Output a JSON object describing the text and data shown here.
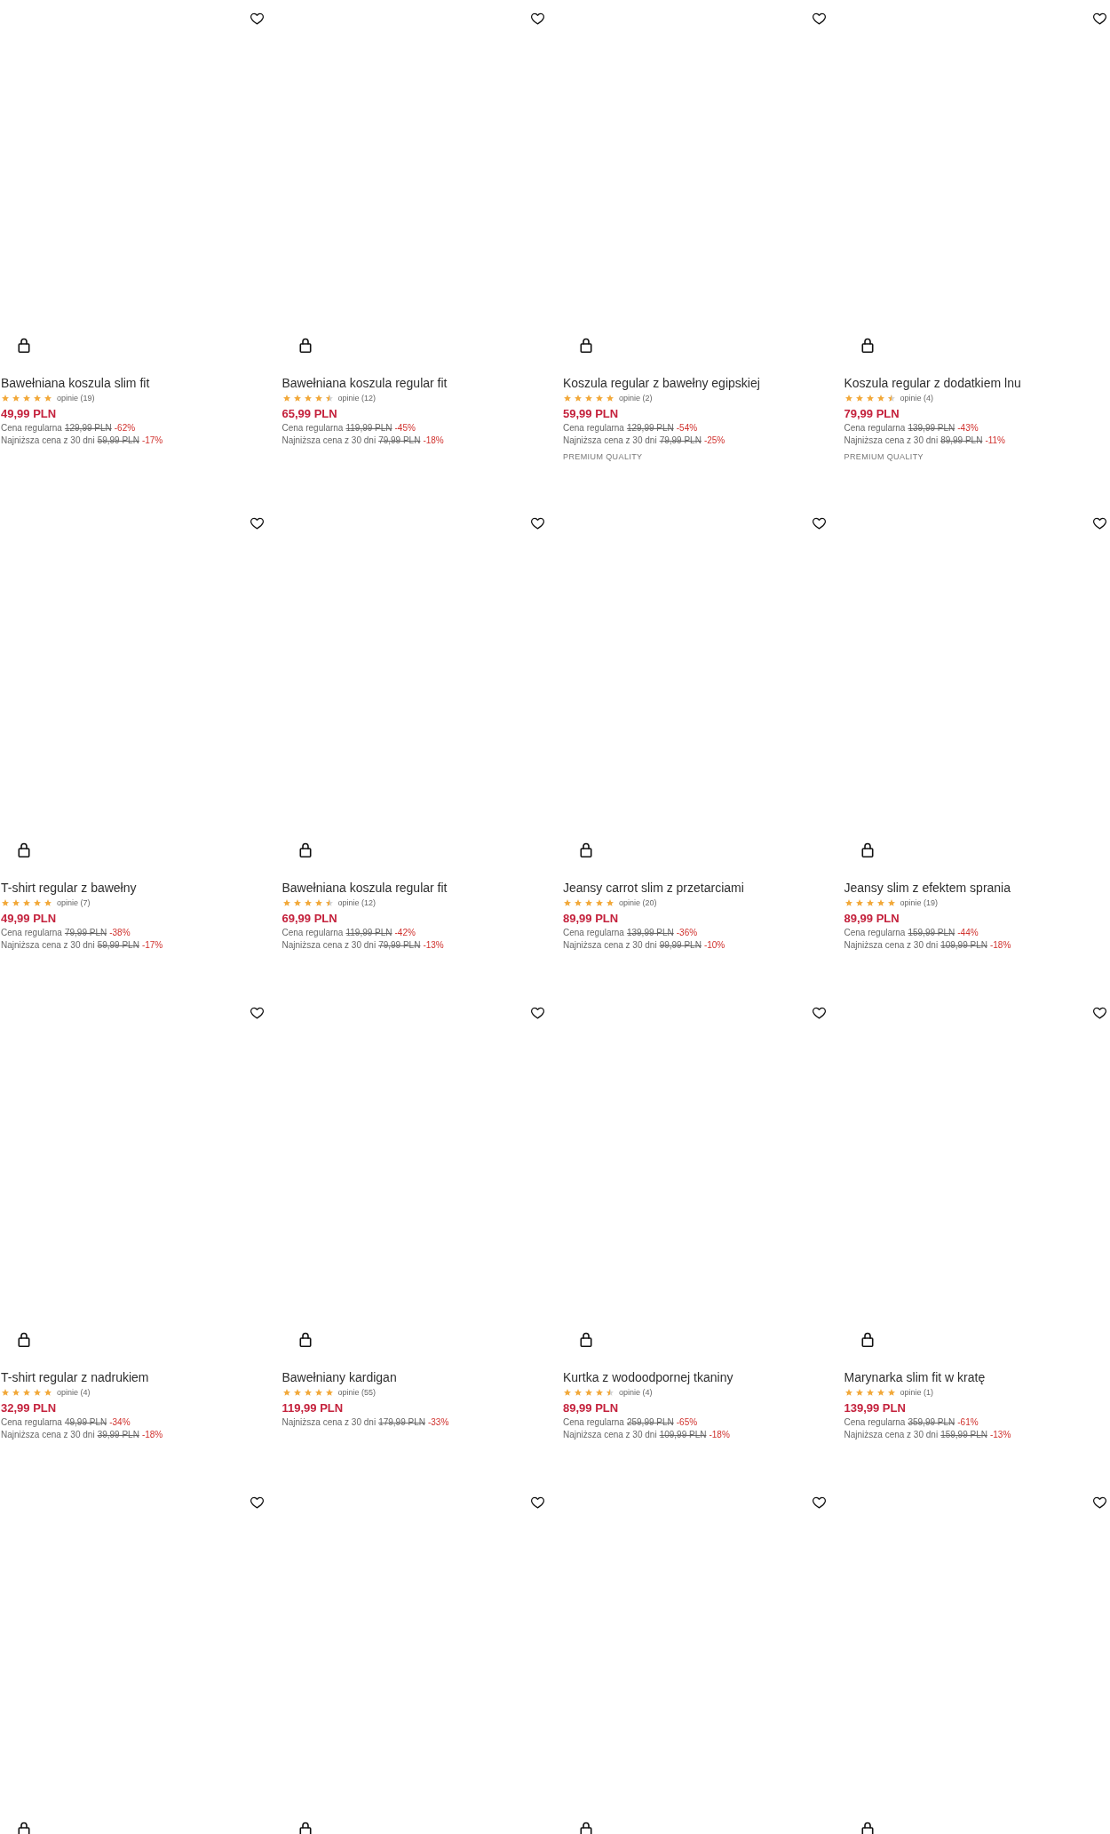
{
  "products": [
    {
      "wishlisted": false,
      "name": "Bawełniana koszula slim fit",
      "stars": 5,
      "reviews": "opinie (19)",
      "price": "49,99 PLN",
      "regular": {
        "label": "Cena regularna",
        "old": "129,99 PLN",
        "discount": "-62%"
      },
      "lowest": {
        "label": "Najniższa cena z 30 dni",
        "old": "59,99 PLN",
        "discount": "-17%"
      }
    },
    {
      "wishlisted": false,
      "name": "Bawełniana koszula regular fit",
      "stars": 4.5,
      "reviews": "opinie (12)",
      "price": "65,99 PLN",
      "regular": {
        "label": "Cena regularna",
        "old": "119,99 PLN",
        "discount": "-45%"
      },
      "lowest": {
        "label": "Najniższa cena z 30 dni",
        "old": "79,99 PLN",
        "discount": "-18%"
      }
    },
    {
      "wishlisted": false,
      "name": "Koszula regular z bawełny egipskiej",
      "stars": 5,
      "reviews": "opinie (2)",
      "price": "59,99 PLN",
      "regular": {
        "label": "Cena regularna",
        "old": "129,99 PLN",
        "discount": "-54%"
      },
      "lowest": {
        "label": "Najniższa cena z 30 dni",
        "old": "79,99 PLN",
        "discount": "-25%"
      },
      "badge": "PREMIUM QUALITY"
    },
    {
      "wishlisted": false,
      "name": "Koszula regular z dodatkiem lnu",
      "stars": 4.5,
      "reviews": "opinie (4)",
      "price": "79,99 PLN",
      "regular": {
        "label": "Cena regularna",
        "old": "139,99 PLN",
        "discount": "-43%"
      },
      "lowest": {
        "label": "Najniższa cena z 30 dni",
        "old": "89,99 PLN",
        "discount": "-11%"
      },
      "badge": "PREMIUM QUALITY"
    },
    {
      "wishlisted": false,
      "name": "T-shirt regular z bawełny",
      "stars": 5,
      "reviews": "opinie (7)",
      "price": "49,99 PLN",
      "regular": {
        "label": "Cena regularna",
        "old": "79,99 PLN",
        "discount": "-38%"
      },
      "lowest": {
        "label": "Najniższa cena z 30 dni",
        "old": "59,99 PLN",
        "discount": "-17%"
      }
    },
    {
      "wishlisted": false,
      "name": "Bawełniana koszula regular fit",
      "stars": 4.5,
      "reviews": "opinie (12)",
      "price": "69,99 PLN",
      "regular": {
        "label": "Cena regularna",
        "old": "119,99 PLN",
        "discount": "-42%"
      },
      "lowest": {
        "label": "Najniższa cena z 30 dni",
        "old": "79,99 PLN",
        "discount": "-13%"
      }
    },
    {
      "wishlisted": false,
      "name": "Jeansy carrot slim z przetarciami",
      "stars": 5,
      "reviews": "opinie (20)",
      "price": "89,99 PLN",
      "regular": {
        "label": "Cena regularna",
        "old": "139,99 PLN",
        "discount": "-36%"
      },
      "lowest": {
        "label": "Najniższa cena z 30 dni",
        "old": "99,99 PLN",
        "discount": "-10%"
      }
    },
    {
      "wishlisted": false,
      "name": "Jeansy slim z efektem sprania",
      "stars": 5,
      "reviews": "opinie (19)",
      "price": "89,99 PLN",
      "regular": {
        "label": "Cena regularna",
        "old": "159,99 PLN",
        "discount": "-44%"
      },
      "lowest": {
        "label": "Najniższa cena z 30 dni",
        "old": "109,99 PLN",
        "discount": "-18%"
      }
    },
    {
      "wishlisted": false,
      "name": "T-shirt regular z nadrukiem",
      "stars": 5,
      "reviews": "opinie (4)",
      "price": "32,99 PLN",
      "regular": {
        "label": "Cena regularna",
        "old": "49,99 PLN",
        "discount": "-34%"
      },
      "lowest": {
        "label": "Najniższa cena z 30 dni",
        "old": "39,99 PLN",
        "discount": "-18%"
      }
    },
    {
      "wishlisted": false,
      "name": "Bawełniany kardigan",
      "stars": 5,
      "reviews": "opinie (55)",
      "price": "119,99 PLN",
      "lowest": {
        "label": "Najniższa cena z 30 dni",
        "old": "179,99 PLN",
        "discount": "-33%"
      }
    },
    {
      "wishlisted": false,
      "name": "Kurtka z wodoodpornej tkaniny",
      "stars": 4.5,
      "reviews": "opinie (4)",
      "price": "89,99 PLN",
      "regular": {
        "label": "Cena regularna",
        "old": "259,99 PLN",
        "discount": "-65%"
      },
      "lowest": {
        "label": "Najniższa cena z 30 dni",
        "old": "109,99 PLN",
        "discount": "-18%"
      }
    },
    {
      "wishlisted": false,
      "name": "Marynarka slim fit w kratę",
      "stars": 5,
      "reviews": "opinie (1)",
      "price": "139,99 PLN",
      "regular": {
        "label": "Cena regularna",
        "old": "359,99 PLN",
        "discount": "-61%"
      },
      "lowest": {
        "label": "Najniższa cena z 30 dni",
        "old": "159,99 PLN",
        "discount": "-13%"
      }
    },
    {
      "wishlisted": false
    },
    {
      "wishlisted": false
    },
    {
      "wishlisted": false
    },
    {
      "wishlisted": false
    }
  ]
}
